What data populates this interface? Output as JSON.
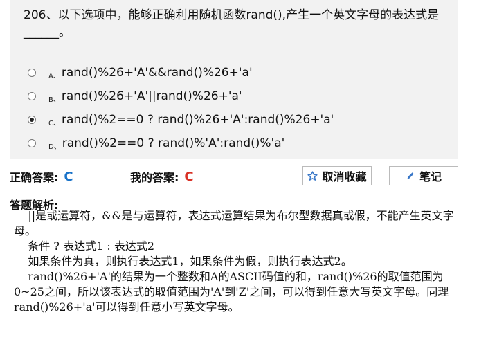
{
  "question": {
    "title": "206、以下选项中，能够正确利用随机函数rand(),产生一个英文字母的表达式是______。",
    "options": [
      {
        "letter": "A、",
        "text": "rand()%26+'A'&&rand()%26+'a'",
        "selected": false
      },
      {
        "letter": "B、",
        "text": "rand()%26+'A'||rand()%26+'a'",
        "selected": false
      },
      {
        "letter": "C、",
        "text": "rand()%2==0 ? rand()%26+'A':rand()%26+'a'",
        "selected": true
      },
      {
        "letter": "D、",
        "text": "rand()%2==0 ? rand()%'A':rand()%'a'",
        "selected": false
      }
    ]
  },
  "answers": {
    "correct_label": "正确答案:",
    "correct_value": "C",
    "mine_label": "我的答案:",
    "mine_value": "C"
  },
  "buttons": {
    "unfavorite": "取消收藏",
    "notes": "笔记"
  },
  "analysis": {
    "title": "答题解析:",
    "text": "    ||是或运算符，&&是与运算符，表达式运算结果为布尔型数据真或假，不能产生英文字母。\n    条件 ? 表达式1 : 表达式2\n    如果条件为真，则执行表达式1，如果条件为假，则执行表达式2。\n    rand()%26+'A'的结果为一个整数和A的ASCII码值的和，rand()%26的取值范围为0~25之间，所以该表达式的取值范围为'A'到'Z'之间，可以得到任意大写英文字母。同理rand()%26+'a'可以得到任意小写英文字母。"
  },
  "colors": {
    "correct": "#1a73c9",
    "mine": "#d93025",
    "button_icon": "#3a78c8"
  }
}
